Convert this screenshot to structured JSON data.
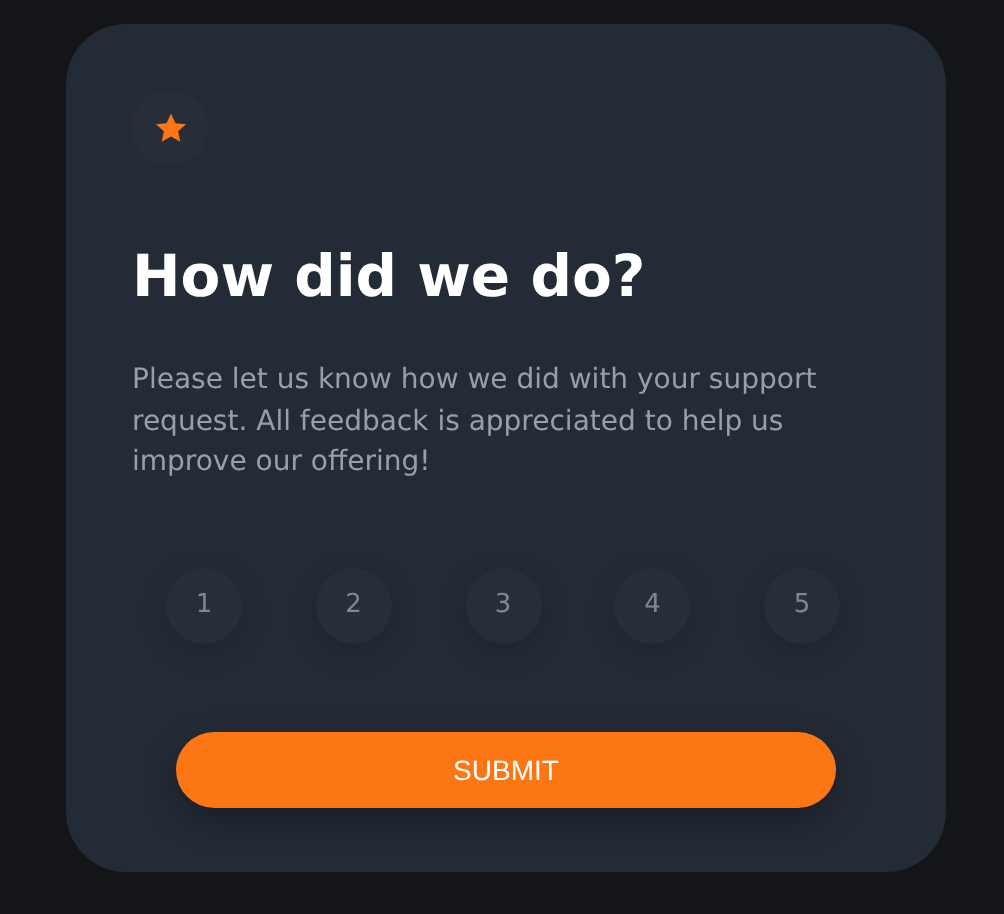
{
  "card": {
    "title": "How did we do?",
    "description": "Please let us know how we did with your support request. All feedback is appreciated to help us improve our offering!"
  },
  "ratings": [
    {
      "label": "1",
      "selected": false
    },
    {
      "label": "2",
      "selected": false
    },
    {
      "label": "3",
      "selected": false
    },
    {
      "label": "4",
      "selected": false
    },
    {
      "label": "5",
      "selected": false
    }
  ],
  "submit": {
    "label": "SUBMIT"
  }
}
